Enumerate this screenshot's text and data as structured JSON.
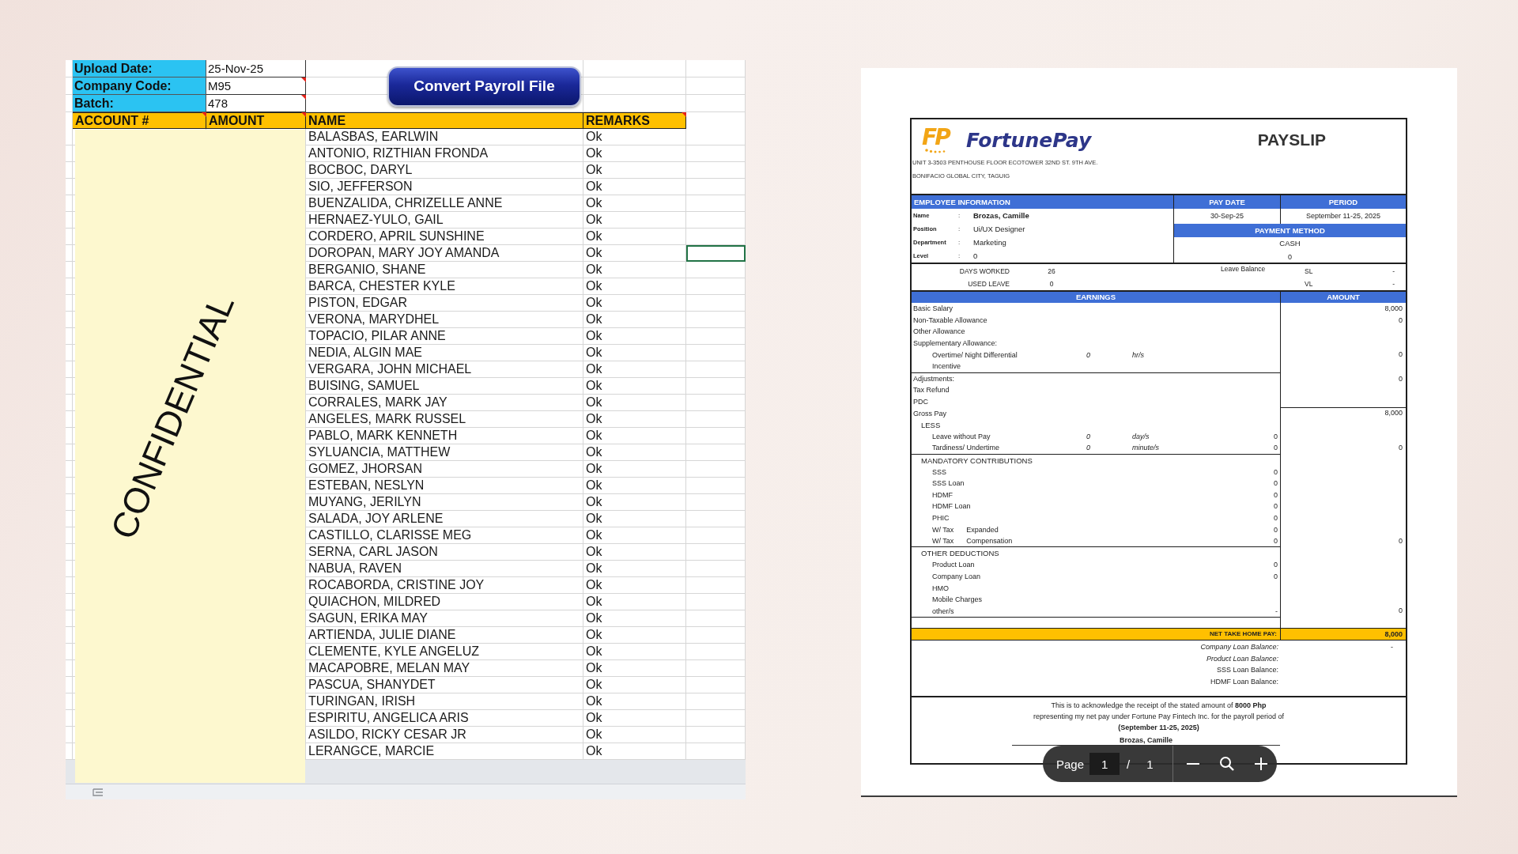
{
  "spreadsheet": {
    "fields": [
      {
        "label": "Upload Date:",
        "value": "25-Nov-25",
        "comment": false
      },
      {
        "label": "Company Code:",
        "value": "M95",
        "comment": true
      },
      {
        "label": "Batch:",
        "value": "478",
        "comment": true
      }
    ],
    "action_button": "Convert Payroll File",
    "columns": [
      {
        "label": "ACCOUNT #",
        "comment": true
      },
      {
        "label": "AMOUNT",
        "comment": true
      },
      {
        "label": "NAME",
        "comment": false
      },
      {
        "label": "REMARKS",
        "comment": true
      }
    ],
    "rows": [
      {
        "name": "BALASBAS, EARLWIN",
        "remarks": "Ok",
        "selected": false
      },
      {
        "name": "ANTONIO, RIZTHIAN FRONDA",
        "remarks": "Ok",
        "selected": false
      },
      {
        "name": "BOCBOC, DARYL",
        "remarks": "Ok",
        "selected": false
      },
      {
        "name": "SIO, JEFFERSON",
        "remarks": "Ok",
        "selected": false
      },
      {
        "name": "BUENZALIDA, CHRIZELLE ANNE",
        "remarks": "Ok",
        "selected": false
      },
      {
        "name": "HERNAEZ-YULO, GAIL",
        "remarks": "Ok",
        "selected": false
      },
      {
        "name": "CORDERO, APRIL SUNSHINE",
        "remarks": "Ok",
        "selected": false
      },
      {
        "name": "DOROPAN, MARY JOY AMANDA",
        "remarks": "Ok",
        "selected": true
      },
      {
        "name": "BERGANIO, SHANE",
        "remarks": "Ok",
        "selected": false
      },
      {
        "name": "BARCA, CHESTER KYLE",
        "remarks": "Ok",
        "selected": false
      },
      {
        "name": "PISTON, EDGAR",
        "remarks": "Ok",
        "selected": false
      },
      {
        "name": "VERONA, MARYDHEL",
        "remarks": "Ok",
        "selected": false
      },
      {
        "name": "TOPACIO, PILAR ANNE",
        "remarks": "Ok",
        "selected": false
      },
      {
        "name": "NEDIA, ALGIN MAE",
        "remarks": "Ok",
        "selected": false
      },
      {
        "name": "VERGARA, JOHN MICHAEL",
        "remarks": "Ok",
        "selected": false
      },
      {
        "name": "BUISING, SAMUEL",
        "remarks": "Ok",
        "selected": false
      },
      {
        "name": "CORRALES, MARK JAY",
        "remarks": "Ok",
        "selected": false
      },
      {
        "name": "ANGELES, MARK RUSSEL",
        "remarks": "Ok",
        "selected": false
      },
      {
        "name": "PABLO, MARK KENNETH",
        "remarks": "Ok",
        "selected": false
      },
      {
        "name": "SYLUANCIA, MATTHEW",
        "remarks": "Ok",
        "selected": false
      },
      {
        "name": "GOMEZ, JHORSAN",
        "remarks": "Ok",
        "selected": false
      },
      {
        "name": "ESTEBAN, NESLYN",
        "remarks": "Ok",
        "selected": false
      },
      {
        "name": "MUYANG, JERILYN",
        "remarks": "Ok",
        "selected": false
      },
      {
        "name": "SALADA, JOY ARLENE",
        "remarks": "Ok",
        "selected": false
      },
      {
        "name": "CASTILLO, CLARISSE MEG",
        "remarks": "Ok",
        "selected": false
      },
      {
        "name": "SERNA, CARL JASON",
        "remarks": "Ok",
        "selected": false
      },
      {
        "name": "NABUA, RAVEN",
        "remarks": "Ok",
        "selected": false
      },
      {
        "name": "ROCABORDA, CRISTINE JOY",
        "remarks": "Ok",
        "selected": false
      },
      {
        "name": "QUIACHON, MILDRED",
        "remarks": "Ok",
        "selected": false
      },
      {
        "name": "SAGUN, ERIKA MAY",
        "remarks": "Ok",
        "selected": false
      },
      {
        "name": "ARTIENDA, JULIE DIANE",
        "remarks": "Ok",
        "selected": false
      },
      {
        "name": "CLEMENTE, KYLE ANGELUZ",
        "remarks": "Ok",
        "selected": false
      },
      {
        "name": "MACAPOBRE, MELAN MAY",
        "remarks": "Ok",
        "selected": false
      },
      {
        "name": "PASCUA, SHANYDET",
        "remarks": "Ok",
        "selected": false
      },
      {
        "name": "TURINGAN, IRISH",
        "remarks": "Ok",
        "selected": false
      },
      {
        "name": "ESPIRITU, ANGELICA ARIS",
        "remarks": "Ok",
        "selected": false
      },
      {
        "name": "ASILDO, RICKY CESAR JR",
        "remarks": "Ok",
        "selected": false
      },
      {
        "name": "LERANGCE, MARCIE",
        "remarks": "Ok",
        "selected": false
      }
    ],
    "overlay_text": "CONFIDENTIAL"
  },
  "pdf_viewer": {
    "payslip": {
      "logo_mark": "FP",
      "brand": "FortunePay",
      "title": "PAYSLIP",
      "address": [
        "UNIT 3-3503 PENTHOUSE FLOOR ECOTOWER 32ND ST. 9TH AVE.",
        "BONIFACIO GLOBAL CITY, TAGUIG"
      ],
      "employee": {
        "header": "EMPLOYEE INFORMATION",
        "fields": [
          {
            "label": "Name",
            "separator": ":",
            "value": "Brozas, Camille",
            "strong": true
          },
          {
            "label": "Position",
            "separator": ":",
            "value": "Ui/UX Designer",
            "strong": false
          },
          {
            "label": "Department",
            "separator": ":",
            "value": "Marketing",
            "strong": false
          },
          {
            "label": "Level",
            "separator": ":",
            "value": "0",
            "strong": false
          }
        ]
      },
      "pay_date": {
        "label": "PAY DATE",
        "value": "30-Sep-25"
      },
      "period": {
        "label": "PERIOD",
        "value": "September 11-25, 2025"
      },
      "payment_method": {
        "label": "PAYMENT METHOD",
        "value": "CASH",
        "note": "0"
      },
      "attendance": [
        {
          "label": "DAYS WORKED",
          "value": "26"
        },
        {
          "label": "USED LEAVE",
          "value": "0"
        }
      ],
      "leave_balance": {
        "label": "Leave Balance",
        "items": [
          {
            "type": "SL",
            "value": "-"
          },
          {
            "type": "VL",
            "value": "-"
          }
        ]
      },
      "earnings_header": "EARNINGS",
      "amount_header": "AMOUNT",
      "groups": [
        {
          "lines": [
            {
              "kind": "line",
              "label": "Basic Salary",
              "amount": "8,000"
            },
            {
              "kind": "line",
              "label": "Non-Taxable Allowance",
              "amount": "0"
            },
            {
              "kind": "line",
              "label": "Other Allowance"
            },
            {
              "kind": "line",
              "label": "Supplementary Allowance:",
              "children": [
                {
                  "kind": "line",
                  "label": "Overtime/ Night Differential",
                  "quantity": "0",
                  "unit": "hr/s",
                  "amount": "0"
                },
                {
                  "kind": "line",
                  "label": "Incentive"
                }
              ]
            }
          ]
        },
        {
          "lines": [
            {
              "kind": "line",
              "label": "Adjustments:",
              "amount": "0"
            },
            {
              "kind": "line",
              "label": "Tax Refund"
            },
            {
              "kind": "line",
              "label": "PDC"
            },
            {
              "kind": "total",
              "label": "Gross Pay",
              "amount": "8,000"
            },
            {
              "kind": "heading",
              "label": "LESS",
              "children": [
                {
                  "kind": "line",
                  "label": "Leave without Pay",
                  "quantity": "0",
                  "unit": "day/s",
                  "subtotal": "0"
                },
                {
                  "kind": "line",
                  "label": "Tardiness/ Undertime",
                  "quantity": "0",
                  "unit": "minute/s",
                  "subtotal": "0",
                  "amount": "0"
                }
              ]
            }
          ]
        },
        {
          "lines": [
            {
              "kind": "heading",
              "label": "MANDATORY CONTRIBUTIONS",
              "children": [
                {
                  "kind": "line",
                  "label": "SSS",
                  "subtotal": "0"
                },
                {
                  "kind": "line",
                  "label": "SSS Loan",
                  "subtotal": "0"
                },
                {
                  "kind": "line",
                  "label": "HDMF",
                  "subtotal": "0"
                },
                {
                  "kind": "line",
                  "label": "HDMF Loan",
                  "subtotal": "0"
                },
                {
                  "kind": "line",
                  "label": "PHIC",
                  "subtotal": "0"
                },
                {
                  "kind": "line",
                  "label": "W/ Tax",
                  "detail": "Expanded",
                  "subtotal": "0"
                },
                {
                  "kind": "line",
                  "label": "W/ Tax",
                  "detail": "Compensation",
                  "subtotal": "0",
                  "amount": "0"
                }
              ]
            }
          ]
        },
        {
          "lines": [
            {
              "kind": "heading",
              "label": "OTHER DEDUCTIONS",
              "children": [
                {
                  "kind": "line",
                  "label": "Product Loan",
                  "subtotal": "0"
                },
                {
                  "kind": "line",
                  "label": "Company Loan",
                  "subtotal": "0"
                },
                {
                  "kind": "line",
                  "label": "HMO"
                },
                {
                  "kind": "line",
                  "label": "Mobile Charges"
                },
                {
                  "kind": "line",
                  "label": "other/s",
                  "subtotal": "-",
                  "amount": "0"
                }
              ]
            }
          ]
        }
      ],
      "net_pay": {
        "label": "NET TAKE HOME PAY:",
        "value": "8,000"
      },
      "balances": [
        {
          "label": "Company Loan Balance:",
          "value": "-",
          "italic": true
        },
        {
          "label": "Product Loan Balance:",
          "italic": true
        },
        {
          "label": "SSS Loan Balance:",
          "italic": false
        },
        {
          "label": "HDMF Loan Balance:",
          "italic": false
        }
      ],
      "acknowledgement": [
        "This is to acknowledge the receipt of the stated amount of **8000 Php**",
        "representing my net pay under Fortune Pay Fintech Inc. for the payroll period of",
        "**(September 11-25, 2025)**"
      ],
      "signature_name": "Brozas, Camille"
    },
    "toolbar": {
      "page_label": "Page",
      "page": "1",
      "separator": "/",
      "page_count": "1"
    }
  }
}
